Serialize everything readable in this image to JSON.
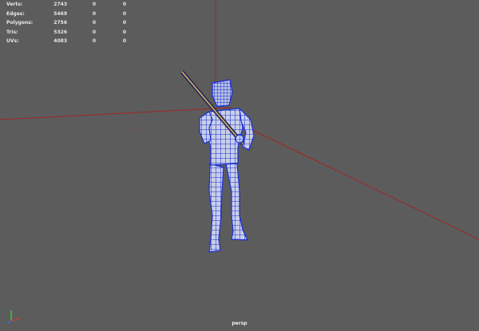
{
  "viewport": {
    "camera_label": "persp",
    "background_color": "#5c5c5c",
    "grid_axis_color": "#a02626",
    "wire_color": "#1a2fd8"
  },
  "hud": {
    "rows": [
      {
        "label": "Verts:",
        "v1": "2743",
        "v2": "0",
        "v3": "0"
      },
      {
        "label": "Edges:",
        "v1": "5469",
        "v2": "0",
        "v3": "0"
      },
      {
        "label": "Polygons:",
        "v1": "2756",
        "v2": "0",
        "v3": "0"
      },
      {
        "label": "Tris:",
        "v1": "5326",
        "v2": "0",
        "v3": "0"
      },
      {
        "label": "UVs:",
        "v1": "4083",
        "v2": "0",
        "v3": "0"
      }
    ]
  },
  "axis_gizmo": {
    "x_color": "#d23a3a",
    "y_color": "#3ad23a",
    "z_color": "#3a6ad2"
  }
}
